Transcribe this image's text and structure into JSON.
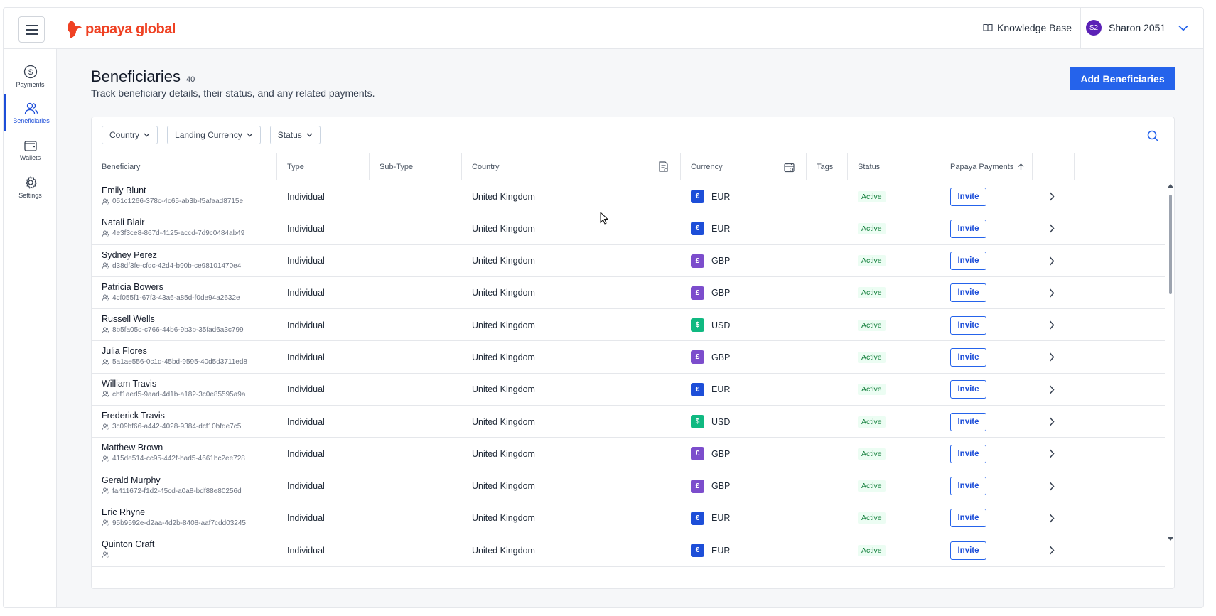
{
  "header": {
    "logo_text": "papaya global",
    "knowledge_base": "Knowledge Base",
    "user_initials": "S2",
    "user_name": "Sharon 2051"
  },
  "sidebar": {
    "items": [
      {
        "label": "Payments",
        "icon": "dollar-circle-icon"
      },
      {
        "label": "Beneficiaries",
        "icon": "users-icon",
        "active": true
      },
      {
        "label": "Wallets",
        "icon": "wallet-icon"
      },
      {
        "label": "Settings",
        "icon": "gear-icon"
      }
    ]
  },
  "page": {
    "title": "Beneficiaries",
    "count": "40",
    "subtitle": "Track beneficiary details, their status, and any related payments.",
    "add_button": "Add Beneficiaries"
  },
  "filters": [
    "Country",
    "Landing Currency",
    "Status"
  ],
  "columns": {
    "beneficiary": "Beneficiary",
    "type": "Type",
    "subtype": "Sub-Type",
    "country": "Country",
    "currency": "Currency",
    "tags": "Tags",
    "status": "Status",
    "papaya_payments": "Papaya Payments"
  },
  "currency_colors": {
    "EUR": "#1d4ed8",
    "GBP": "#7c4dcc",
    "USD": "#10b981"
  },
  "currency_symbols": {
    "EUR": "€",
    "GBP": "£",
    "USD": "$"
  },
  "rows": [
    {
      "name": "Emily Blunt",
      "id": "051c1266-378c-4c65-ab3b-f5afaad8715e",
      "type": "Individual",
      "country": "United Kingdom",
      "currency": "EUR",
      "status": "Active",
      "action": "Invite"
    },
    {
      "name": "Natali Blair",
      "id": "4e3f3ce8-867d-4125-accd-7d9c0484ab49",
      "type": "Individual",
      "country": "United Kingdom",
      "currency": "EUR",
      "status": "Active",
      "action": "Invite"
    },
    {
      "name": "Sydney Perez",
      "id": "d38df3fe-cfdc-42d4-b90b-ce98101470e4",
      "type": "Individual",
      "country": "United Kingdom",
      "currency": "GBP",
      "status": "Active",
      "action": "Invite"
    },
    {
      "name": "Patricia Bowers",
      "id": "4cf055f1-67f3-43a6-a85d-f0de94a2632e",
      "type": "Individual",
      "country": "United Kingdom",
      "currency": "GBP",
      "status": "Active",
      "action": "Invite"
    },
    {
      "name": "Russell Wells",
      "id": "8b5fa05d-c766-44b6-9b3b-35fad6a3c799",
      "type": "Individual",
      "country": "United Kingdom",
      "currency": "USD",
      "status": "Active",
      "action": "Invite"
    },
    {
      "name": "Julia Flores",
      "id": "5a1ae556-0c1d-45bd-9595-40d5d3711ed8",
      "type": "Individual",
      "country": "United Kingdom",
      "currency": "GBP",
      "status": "Active",
      "action": "Invite"
    },
    {
      "name": "William Travis",
      "id": "cbf1aed5-9aad-4d1b-a182-3c0e85595a9a",
      "type": "Individual",
      "country": "United Kingdom",
      "currency": "EUR",
      "status": "Active",
      "action": "Invite"
    },
    {
      "name": "Frederick Travis",
      "id": "3c09bf66-a442-4028-9384-dcf10bfde7c5",
      "type": "Individual",
      "country": "United Kingdom",
      "currency": "USD",
      "status": "Active",
      "action": "Invite"
    },
    {
      "name": "Matthew Brown",
      "id": "415de514-cc95-442f-bad5-4661bc2ee728",
      "type": "Individual",
      "country": "United Kingdom",
      "currency": "GBP",
      "status": "Active",
      "action": "Invite"
    },
    {
      "name": "Gerald Murphy",
      "id": "fa411672-f1d2-45cd-a0a8-bdf88e80256d",
      "type": "Individual",
      "country": "United Kingdom",
      "currency": "GBP",
      "status": "Active",
      "action": "Invite"
    },
    {
      "name": "Eric Rhyne",
      "id": "95b9592e-d2aa-4d2b-8408-aaf7cdd03245",
      "type": "Individual",
      "country": "United Kingdom",
      "currency": "EUR",
      "status": "Active",
      "action": "Invite"
    },
    {
      "name": "Quinton Craft",
      "id": "",
      "type": "Individual",
      "country": "United Kingdom",
      "currency": "EUR",
      "status": "Active",
      "action": "Invite"
    }
  ]
}
